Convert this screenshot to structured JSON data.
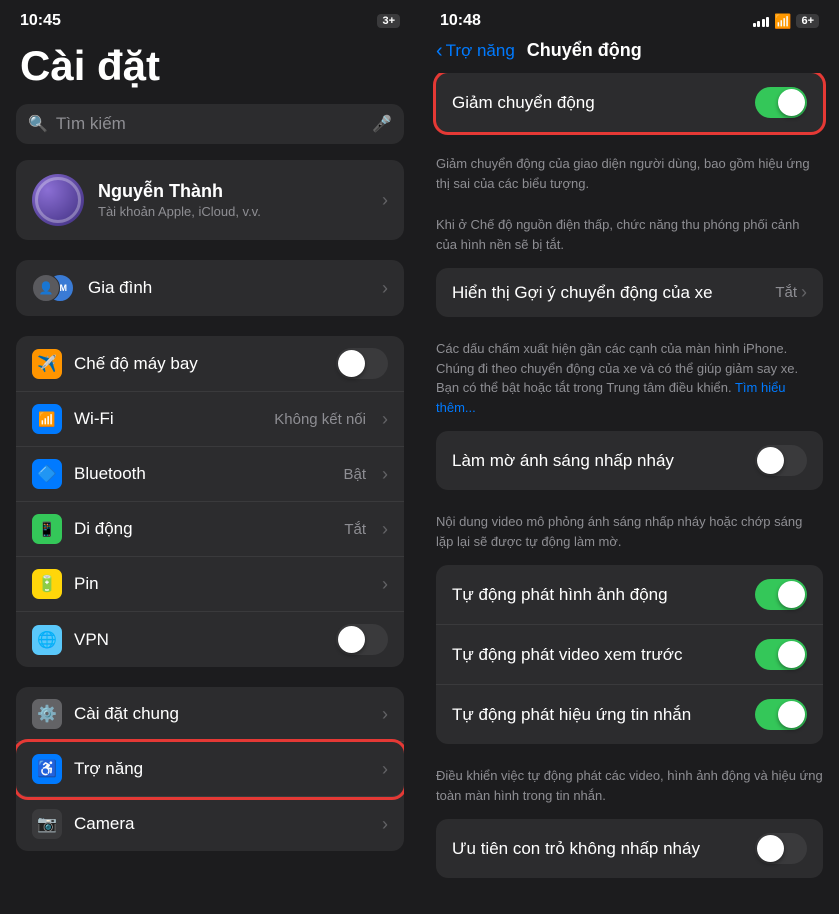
{
  "left": {
    "statusBar": {
      "time": "10:45",
      "battery": "3+"
    },
    "title": "Cài đặt",
    "search": {
      "placeholder": "Tìm kiếm"
    },
    "profile": {
      "name": "Nguyễn Thành",
      "sub": "Tài khoản Apple, iCloud, v.v."
    },
    "family": {
      "label": "Gia đình"
    },
    "settingsGroups": [
      {
        "id": "group1",
        "items": [
          {
            "icon": "✈",
            "iconBg": "orange",
            "label": "Chế độ máy bay",
            "type": "toggle",
            "value": "off"
          },
          {
            "icon": "📶",
            "iconBg": "blue",
            "label": "Wi-Fi",
            "value": "Không kết nối",
            "type": "arrow"
          },
          {
            "icon": "🔵",
            "iconBg": "blue2",
            "label": "Bluetooth",
            "value": "Bật",
            "type": "arrow"
          },
          {
            "icon": "📱",
            "iconBg": "green",
            "label": "Di động",
            "value": "Tắt",
            "type": "arrow"
          },
          {
            "icon": "🔋",
            "iconBg": "yellow",
            "label": "Pin",
            "type": "arrow"
          },
          {
            "icon": "🌐",
            "iconBg": "teal",
            "label": "VPN",
            "type": "toggle",
            "value": "off"
          }
        ]
      }
    ],
    "settingsGroup2": {
      "items": [
        {
          "icon": "⚙",
          "iconBg": "gray",
          "label": "Cài đặt chung",
          "type": "arrow"
        },
        {
          "icon": "♿",
          "iconBg": "blue",
          "label": "Trợ năng",
          "type": "arrow",
          "highlight": true
        },
        {
          "icon": "📷",
          "iconBg": "dark",
          "label": "Camera",
          "type": "arrow"
        }
      ]
    }
  },
  "right": {
    "statusBar": {
      "time": "10:48",
      "battery": "6+"
    },
    "nav": {
      "back": "Trợ năng",
      "title": "Chuyển động"
    },
    "sections": [
      {
        "id": "reduce-motion",
        "highlight": true,
        "rows": [
          {
            "label": "Giảm chuyển động",
            "type": "toggle",
            "value": "on"
          }
        ],
        "description": "Giảm chuyển động của giao diện người dùng, bao gồm hiệu ứng thị sai của các biểu tượng."
      },
      {
        "id": "low-power-desc",
        "descriptionOnly": true,
        "description": "Khi ở Chế độ nguồn điện thấp, chức năng thu phóng phối cảnh của hình nền sẽ bị tắt."
      },
      {
        "id": "motion-suggestions",
        "rows": [
          {
            "label": "Hiển thị Gợi ý chuyển động của xe",
            "value": "Tắt",
            "type": "arrow"
          }
        ],
        "description": "Các dấu chấm xuất hiện gần các cạnh của màn hình iPhone. Chúng đi theo chuyển động của xe và có thể giúp giảm say xe. Bạn có thể bật hoặc tắt trong Trung tâm điều khiển.",
        "hasLink": true,
        "linkText": "Tìm hiểu thêm..."
      },
      {
        "id": "dim-flash",
        "rows": [
          {
            "label": "Làm mờ ánh sáng nhấp nháy",
            "type": "toggle",
            "value": "off"
          }
        ],
        "description": "Nội dung video mô phỏng ánh sáng nhấp nháy hoặc chớp sáng lặp lại sẽ được tự động làm mờ."
      },
      {
        "id": "auto-play",
        "rows": [
          {
            "label": "Tự động phát hình ảnh động",
            "type": "toggle",
            "value": "on"
          },
          {
            "label": "Tự động phát video xem trước",
            "type": "toggle",
            "value": "on"
          },
          {
            "label": "Tự động phát hiệu ứng tin nhắn",
            "type": "toggle",
            "value": "on"
          }
        ],
        "description": "Điều khiển việc tự động phát các video, hình ảnh động và hiệu ứng toàn màn hình trong tin nhắn."
      },
      {
        "id": "cursor",
        "rows": [
          {
            "label": "Ưu tiên con trỏ không nhấp nháy",
            "type": "toggle",
            "value": "off"
          }
        ]
      }
    ]
  }
}
